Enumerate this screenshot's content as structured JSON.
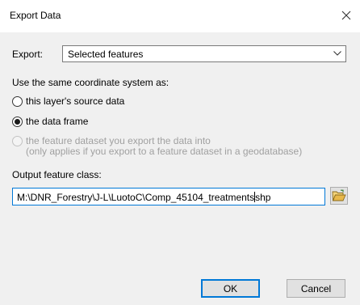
{
  "window": {
    "title": "Export Data"
  },
  "export": {
    "label": "Export:",
    "selected": "Selected features"
  },
  "coordinate_system": {
    "label": "Use the same coordinate system as:",
    "options": [
      {
        "label": "this layer's source data",
        "checked": false,
        "enabled": true
      },
      {
        "label": "the data frame",
        "checked": true,
        "enabled": true
      },
      {
        "label": "the feature dataset you export the data into",
        "note": "(only applies if you export to a feature dataset in a geodatabase)",
        "checked": false,
        "enabled": false
      }
    ]
  },
  "output": {
    "label": "Output feature class:",
    "value_before_caret": "M:\\DNR_Forestry\\J-L\\LuotoC\\Comp_45104_treatments",
    "value_after_caret": "shp"
  },
  "buttons": {
    "ok": "OK",
    "cancel": "Cancel"
  },
  "colors": {
    "accent": "#0078d7",
    "folder": "#e8b84a"
  },
  "icons": {
    "close": "close-icon",
    "dropdown": "chevron-down-icon",
    "browse": "folder-open-icon"
  }
}
